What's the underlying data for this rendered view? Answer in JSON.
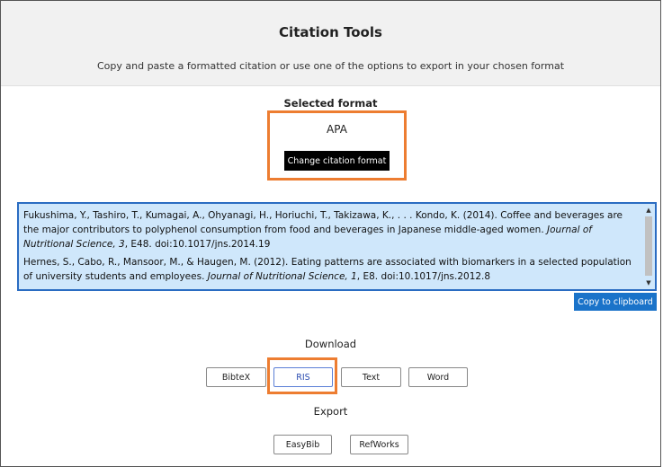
{
  "header": {
    "title": "Citation Tools",
    "subtitle": "Copy and paste a formatted citation or use one of the options to export in your chosen format"
  },
  "format": {
    "label": "Selected format",
    "value": "APA",
    "change_label": "Change citation format"
  },
  "citations": [
    {
      "text_before": "Fukushima, Y., Tashiro, T., Kumagai, A., Ohyanagi, H., Horiuchi, T., Takizawa, K., . . . Kondo, K. (2014). Coffee and beverages are the major contributors to polyphenol consumption from food and beverages in Japanese middle-aged women. ",
      "journal": "Journal of Nutritional Science, 3",
      "text_after": ", E48. doi:10.1017/jns.2014.19"
    },
    {
      "text_before": "Hernes, S., Cabo, R., Mansoor, M., & Haugen, M. (2012). Eating patterns are associated with biomarkers in a selected population of university students and employees. ",
      "journal": "Journal of Nutritional Science, 1",
      "text_after": ", E8. doi:10.1017/jns.2012.8"
    }
  ],
  "copy_label": "Copy to clipboard",
  "download": {
    "label": "Download",
    "buttons": [
      "BibteX",
      "RIS",
      "Text",
      "Word"
    ]
  },
  "export": {
    "label": "Export",
    "buttons": [
      "EasyBib",
      "RefWorks"
    ]
  },
  "colors": {
    "highlight": "#ed7d31",
    "citation_bg": "#cfe7fb",
    "citation_border": "#2a6cc2",
    "copy_button": "#1a73c9"
  }
}
